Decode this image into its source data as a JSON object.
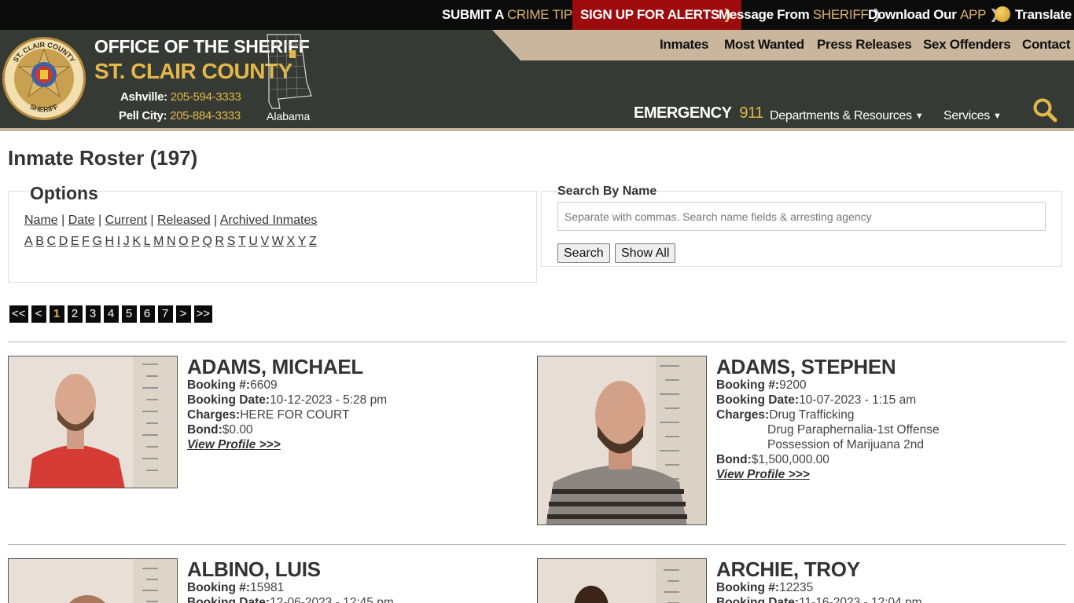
{
  "topbar": {
    "crime_tip": {
      "pre": "SUBMIT A ",
      "accent": "CRIME TIP"
    },
    "alerts": {
      "label": "SIGN UP FOR ALERTS"
    },
    "message": {
      "pre": "Message From ",
      "accent": "SHERIFF"
    },
    "app": {
      "pre": "Download Our ",
      "accent": "APP"
    },
    "translate": "Translate"
  },
  "header": {
    "title_line1": "OFFICE OF THE SHERIFF",
    "title_line2": "ST. CLAIR COUNTY",
    "phones": [
      {
        "label": "Ashville:",
        "number": "205-594-3333"
      },
      {
        "label": "Pell City:",
        "number": "205-884-3333"
      }
    ],
    "state": "Alabama",
    "badge_text": {
      "top": "ST. CLAIR COUNTY",
      "bottom": "SHERIFF"
    },
    "emergency": {
      "label": "EMERGENCY",
      "number": "911"
    },
    "nav": [
      "Inmates",
      "Most Wanted",
      "Press Releases",
      "Sex Offenders",
      "Contact"
    ],
    "dropdowns": [
      "Departments & Resources",
      "Services"
    ],
    "colors": {
      "dark": "#353a34",
      "gold": "#e4b74a",
      "tan": "#c9b69c",
      "alert_red": "#9e0b0f"
    }
  },
  "main": {
    "title": "Inmate Roster (197)",
    "options": {
      "legend": "Options",
      "sort_links": [
        "Name",
        "Date",
        "Current",
        "Released",
        "Archived Inmates"
      ],
      "letters": [
        "A",
        "B",
        "C",
        "D",
        "E",
        "F",
        "G",
        "H",
        "I",
        "J",
        "K",
        "L",
        "M",
        "N",
        "O",
        "P",
        "Q",
        "R",
        "S",
        "T",
        "U",
        "V",
        "W",
        "X",
        "Y",
        "Z"
      ]
    },
    "search": {
      "legend": "Search By Name",
      "placeholder": "Separate with commas. Search name fields & arresting agency",
      "search_label": "Search",
      "show_all_label": "Show All"
    },
    "pager": {
      "first": "<<",
      "prev": "<",
      "pages": [
        "1",
        "2",
        "3",
        "4",
        "5",
        "6",
        "7"
      ],
      "current": "1",
      "next": ">",
      "last": ">>"
    },
    "labels": {
      "booking_no": "Booking #:",
      "booking_date": "Booking Date:",
      "charges": "Charges:",
      "bond": "Bond:",
      "view_profile": "View Profile >>>"
    },
    "inmates": [
      {
        "name": "ADAMS, MICHAEL",
        "booking_no": "6609",
        "booking_date": "10-12-2023 - 5:28 pm",
        "charges": [
          "HERE FOR COURT"
        ],
        "bond": "$0.00"
      },
      {
        "name": "ADAMS, STEPHEN",
        "booking_no": "9200",
        "booking_date": "10-07-2023 - 1:15 am",
        "charges": [
          "Drug Trafficking",
          "Drug Paraphernalia-1st Offense",
          "Possession of Marijuana 2nd"
        ],
        "bond": "$1,500,000.00"
      },
      {
        "name": "ALBINO, LUIS",
        "booking_no": "15981",
        "booking_date": "12-06-2023 - 12:45 pm"
      },
      {
        "name": "ARCHIE, TROY",
        "booking_no": "12235",
        "booking_date": "11-16-2023 - 12:04 pm"
      }
    ]
  }
}
